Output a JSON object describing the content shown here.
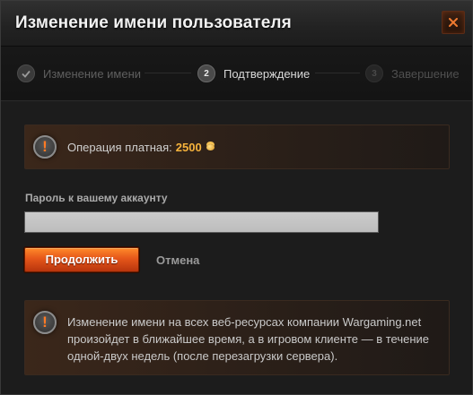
{
  "dialog": {
    "title": "Изменение имени пользователя",
    "close_icon": "close-icon"
  },
  "stepper": {
    "steps": [
      {
        "number": "",
        "label": "Изменение имени",
        "state": "completed",
        "icon": "checkmark-icon"
      },
      {
        "number": "2",
        "label": "Подтверждение",
        "state": "active"
      },
      {
        "number": "3",
        "label": "Завершение",
        "state": "pending"
      }
    ]
  },
  "cost": {
    "label": "Операция платная:",
    "amount": "2500",
    "currency_icon": "gold-coins-icon",
    "icon": "warning-icon",
    "icon_glyph": "!"
  },
  "password": {
    "label": "Пароль к вашему аккаунту",
    "value": "",
    "placeholder": ""
  },
  "actions": {
    "continue_label": "Продолжить",
    "cancel_label": "Отмена"
  },
  "info": {
    "icon": "warning-icon",
    "icon_glyph": "!",
    "text": "Изменение имени на всех веб-ресурсах компании Wargaming.net произойдет в ближайшее время, а в игровом клиенте — в течение одной-двух недель (после перезагрузки сервера)."
  },
  "colors": {
    "accent_orange": "#e5561a",
    "gold": "#f6b33c",
    "background": "#1c1c1c"
  }
}
